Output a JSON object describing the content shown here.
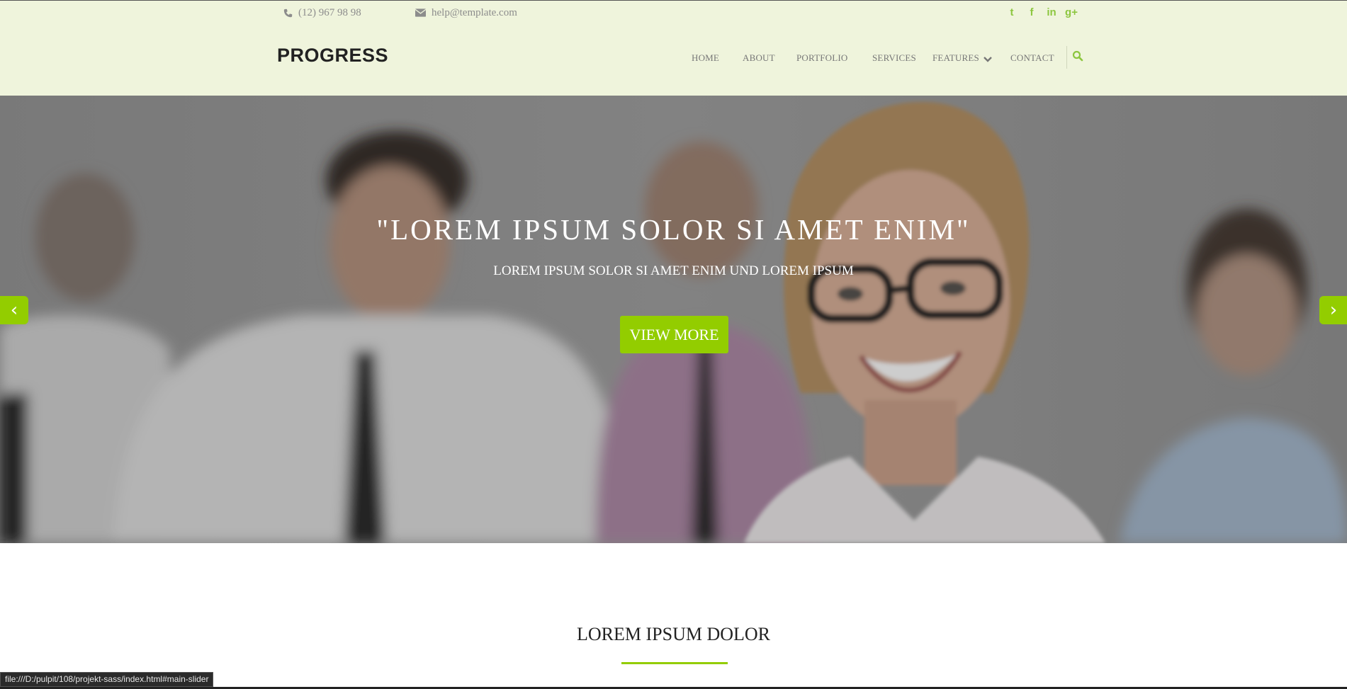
{
  "topbar": {
    "phone": "(12) 967 98 98",
    "email": "help@template.com",
    "social_icons": [
      "twitter-icon",
      "facebook-icon",
      "linkedin-icon",
      "google-plus-icon"
    ],
    "social_glyphs": [
      "t",
      "f",
      "in",
      "g+"
    ]
  },
  "logo": "PROGRESS",
  "nav": {
    "items": [
      "HOME",
      "ABOUT",
      "PORTFOLIO",
      "SERVICES",
      "FEATURES",
      "CONTACT"
    ]
  },
  "hero": {
    "title": "\"LOREM IPSUM SOLOR SI AMET ENIM\"",
    "subtitle": "LOREM IPSUM SOLOR SI AMET ENIM UND LOREM IPSUM",
    "button": "VIEW MORE",
    "prev": "‹",
    "next": "›"
  },
  "section": {
    "title": "LOREM IPSUM DOLOR"
  },
  "status_url": "file:///D:/pulpit/108/projekt-sass/index.html#main-slider",
  "colors": {
    "accent": "#93cd00",
    "header_bg": "#eff4dc",
    "text_muted": "#8c8c8c"
  }
}
